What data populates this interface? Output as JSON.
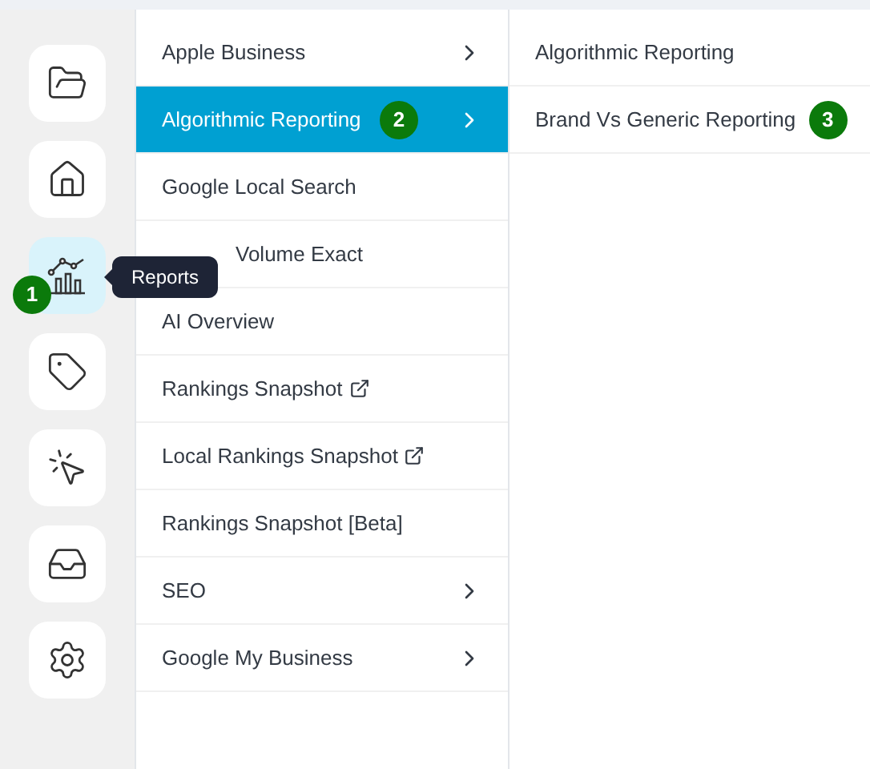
{
  "sidebar": {
    "items": [
      {
        "kind": "folder",
        "selected": false
      },
      {
        "kind": "home",
        "selected": false
      },
      {
        "kind": "chart",
        "selected": true,
        "badge": "1",
        "tooltip": "Reports"
      },
      {
        "kind": "tag",
        "selected": false
      },
      {
        "kind": "click",
        "selected": false
      },
      {
        "kind": "inbox",
        "selected": false
      },
      {
        "kind": "settings",
        "selected": false
      }
    ]
  },
  "menu": {
    "items": [
      {
        "label": "Apple Business",
        "selected": false,
        "submenu": true,
        "external": false
      },
      {
        "label": "Algorithmic Reporting",
        "selected": true,
        "submenu": true,
        "external": false,
        "badge": "2"
      },
      {
        "label": "Google Local Search",
        "selected": false,
        "submenu": false,
        "external": false
      },
      {
        "label": "Volume Exact",
        "selected": false,
        "submenu": false,
        "external": false
      },
      {
        "label": "AI Overview",
        "selected": false,
        "submenu": false,
        "external": false
      },
      {
        "label": "Rankings Snapshot",
        "selected": false,
        "submenu": false,
        "external": true
      },
      {
        "label": "Local Rankings Snapshot",
        "selected": false,
        "submenu": false,
        "external": true
      },
      {
        "label": "Rankings Snapshot [Beta]",
        "selected": false,
        "submenu": false,
        "external": false
      },
      {
        "label": "SEO",
        "selected": false,
        "submenu": true,
        "external": false
      },
      {
        "label": "Google My Business",
        "selected": false,
        "submenu": true,
        "external": false
      }
    ]
  },
  "submenu": {
    "items": [
      {
        "label": "Algorithmic Reporting"
      },
      {
        "label": "Brand Vs Generic Reporting",
        "badge": "3"
      }
    ]
  }
}
